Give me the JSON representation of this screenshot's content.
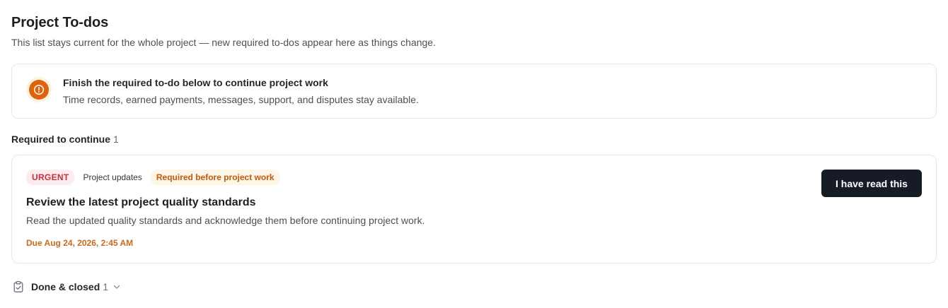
{
  "header": {
    "title": "Project To-dos",
    "subtitle": "This list stays current for the whole project — new required to-dos appear here as things change."
  },
  "alert": {
    "icon": "alert-circle-icon",
    "title": "Finish the required to-do below to continue project work",
    "text": "Time records, earned payments, messages, support, and disputes stay available."
  },
  "required_section": {
    "heading": "Required to continue",
    "count": "1"
  },
  "todo": {
    "badges": {
      "urgent": "URGENT",
      "category": "Project updates",
      "requirement": "Required before project work"
    },
    "title": "Review the latest project quality standards",
    "description": "Read the updated quality standards and acknowledge them before continuing project work.",
    "due": "Due Aug 24, 2026, 2:45 AM",
    "action_label": "I have read this"
  },
  "done_section": {
    "icon": "clipboard-check-icon",
    "label": "Done & closed",
    "count": "1",
    "toggle_icon": "chevron-down-icon"
  },
  "colors": {
    "accent_orange": "#e0620b",
    "button_dark": "#161b26",
    "urgent_red": "#c9303c",
    "due_orange": "#cd6a1a"
  }
}
